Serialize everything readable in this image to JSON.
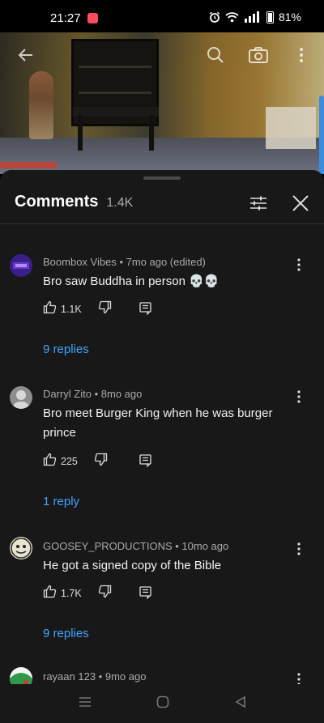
{
  "status_bar": {
    "time": "21:27",
    "battery": "81%",
    "icons": [
      "recording-badge-icon",
      "alarm-icon",
      "wifi-icon",
      "signal-icon",
      "battery-icon"
    ]
  },
  "video": {
    "icons": [
      "back-arrow-icon",
      "search-icon",
      "camera-icon",
      "more-vertical-icon"
    ]
  },
  "comments": {
    "title": "Comments",
    "count": "1.4K",
    "items": [
      {
        "author": "Boombox Vibes",
        "time": "7mo ago (edited)",
        "text": "Bro saw Buddha in person 💀💀",
        "likes": "1.1K",
        "replies": "9 replies",
        "avatar_color": "#3a1e8a"
      },
      {
        "author": "Darryl Zito",
        "time": "8mo ago",
        "text": "Bro meet Burger King when he was burger prince",
        "likes": "225",
        "replies": "1 reply",
        "avatar_color": "#9a9a9a"
      },
      {
        "author": "GOOSEY_PRODUCTIONS",
        "time": "10mo ago",
        "text": "He got a signed copy of the Bible",
        "likes": "1.7K",
        "replies": "9 replies",
        "avatar_color": "#e8e2d0"
      },
      {
        "author": "rayaan 123",
        "time": "9mo ago",
        "avatar_color": "#2f9a4a"
      }
    ],
    "separator": " • "
  },
  "colors": {
    "sheet_bg": "#181818",
    "link": "#3ea6ff",
    "meta": "#aaaaaa"
  },
  "nav_icons": [
    "recents-icon",
    "home-icon",
    "back-icon"
  ]
}
